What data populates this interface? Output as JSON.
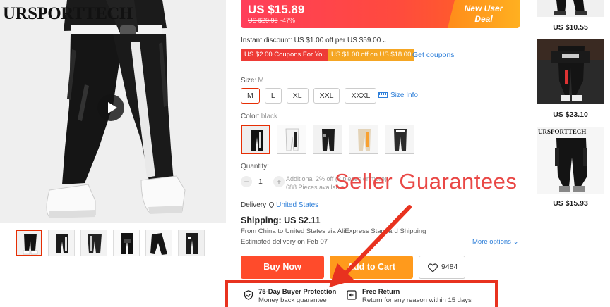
{
  "gallery": {
    "brand_logo_text": "URSPORTTECH",
    "thumbnails": [
      "thumb-1",
      "thumb-2",
      "thumb-3",
      "thumb-4",
      "thumb-5",
      "thumb-6"
    ],
    "selected_index": 0
  },
  "price": {
    "current": "US $15.89",
    "original": "US $29.98",
    "discount": "-47%",
    "badge_line1": "New User",
    "badge_line2": "Deal"
  },
  "discounts": {
    "instant": "Instant discount: US $1.00 off per US $59.00",
    "coupon1": "US $2.00 Coupons For You",
    "coupon2": "US $1.00 off on US $18.00",
    "get_coupons": "Get coupons"
  },
  "size": {
    "label": "Size:",
    "selected": "M",
    "options": [
      "M",
      "L",
      "XL",
      "XXL",
      "XXXL"
    ],
    "size_info": "Size Info"
  },
  "color": {
    "label": "Color:",
    "selected": "black",
    "option_count": 5
  },
  "quantity": {
    "label": "Quantity:",
    "value": "1",
    "minus": "−",
    "plus": "+",
    "note_line1": "Additional 2% off (3 pieces or more)",
    "note_line2": "688 Pieces available"
  },
  "annotation": {
    "text": "Seller Guarantees",
    "color": "#e94846"
  },
  "delivery": {
    "label": "Delivery",
    "location": "United States",
    "shipping": "Shipping: US $2.11",
    "route": "From China to United States via AliExpress Standard Shipping",
    "estimate": "Estimated delivery on Feb 07",
    "more_options": "More options"
  },
  "actions": {
    "buy_now": "Buy Now",
    "add_to_cart": "Add to Cart",
    "wishlist_count": "9484"
  },
  "guarantees": [
    {
      "title": "75-Day Buyer Protection",
      "subtitle": "Money back guarantee",
      "icon": "shield-check-icon"
    },
    {
      "title": "Free Return",
      "subtitle": "Return for any reason within 15 days",
      "icon": "return-box-icon"
    }
  ],
  "side_products": [
    {
      "price": "US $10.55"
    },
    {
      "price": "US $23.10"
    },
    {
      "price": "US $15.93"
    }
  ],
  "colors": {
    "accent_red": "#e62e04",
    "link_blue": "#2e7fd9",
    "buy_now": "#ff4b2b",
    "add_to_cart": "#ff9a1c",
    "annotation_box": "#e8321f"
  }
}
